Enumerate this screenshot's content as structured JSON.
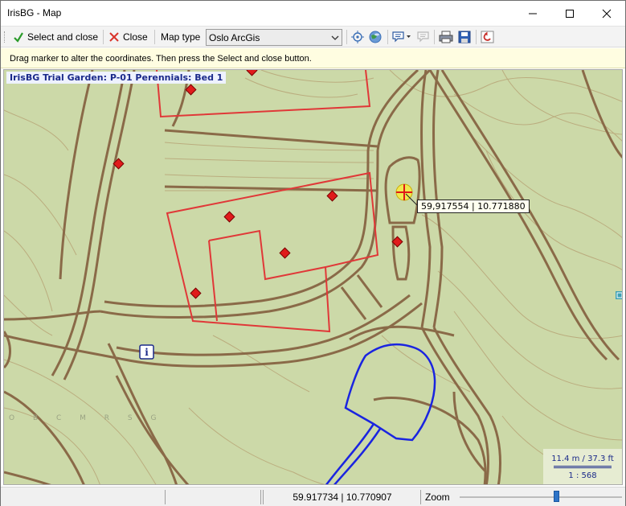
{
  "window": {
    "title": "IrisBG - Map"
  },
  "toolbar": {
    "select_close_label": "Select and close",
    "close_label": "Close",
    "map_type_label": "Map type",
    "map_type_value": "Oslo ArcGis"
  },
  "hint": "Drag marker to alter the coordinates. Then press the Select and close button.",
  "map": {
    "title": "IrisBG Trial Garden: P-01 Perennials: Bed 1",
    "marker_coords": "59,917554 | 10.771880",
    "watermark": "O B C M R S G",
    "scale_distance": "11.4 m / 37.3 ft",
    "scale_ratio": "1 : 568"
  },
  "status": {
    "coords": "59.917734 | 10.770907",
    "zoom_label": "Zoom",
    "zoom_fraction": 0.6
  }
}
